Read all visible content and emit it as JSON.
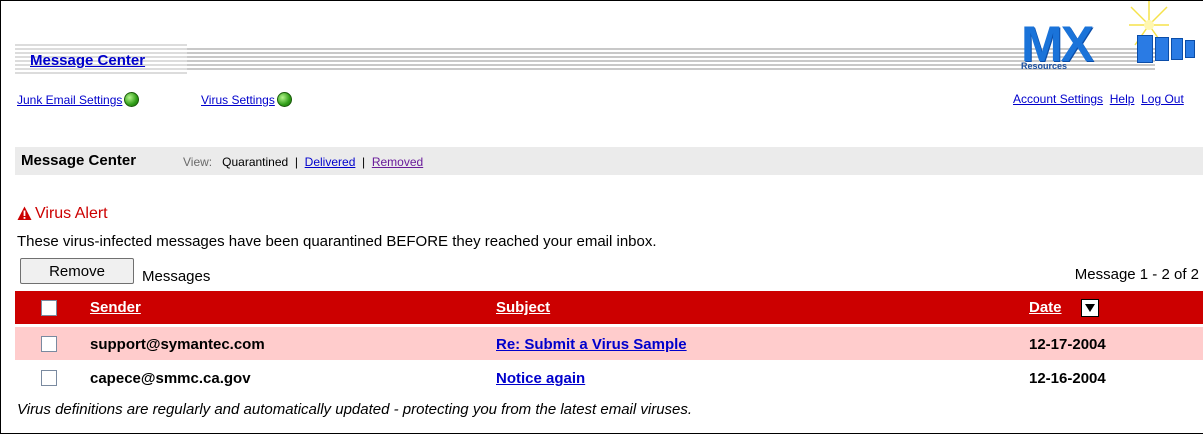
{
  "header": {
    "title": "Message Center",
    "logo_text": "MX",
    "logo_subtitle": "Resources"
  },
  "nav": {
    "left": [
      {
        "label": "Junk Email Settings",
        "status_color": "#2f9d17"
      },
      {
        "label": "Virus Settings",
        "status_color": "#2f9d17"
      }
    ],
    "right": [
      "Account Settings",
      "Help",
      "Log Out"
    ]
  },
  "viewbar": {
    "title": "Message Center",
    "view_label": "View:",
    "current": "Quarantined",
    "links": [
      "Delivered",
      "Removed"
    ],
    "separator": "|"
  },
  "alert": {
    "title": "Virus Alert",
    "description": "These virus-infected messages have been quarantined BEFORE they reached your email inbox.",
    "icon": "warning-triangle-icon"
  },
  "actions": {
    "remove_label": "Remove",
    "messages_label": "Messages",
    "count_label": "Message 1 - 2 of 2"
  },
  "table": {
    "columns": [
      "Sender",
      "Subject",
      "Date"
    ],
    "rows": [
      {
        "sender": "support@symantec.com",
        "subject": "Re: Submit a Virus Sample",
        "date": "12-17-2004"
      },
      {
        "sender": "capece@smmc.ca.gov",
        "subject": "Notice again",
        "date": "12-16-2004"
      }
    ]
  },
  "footnote": "Virus definitions are regularly and automatically updated - protecting you from the latest email viruses.",
  "colors": {
    "header_red": "#cc0000",
    "row_highlight": "#ffcccc",
    "link_blue": "#0000cc"
  }
}
